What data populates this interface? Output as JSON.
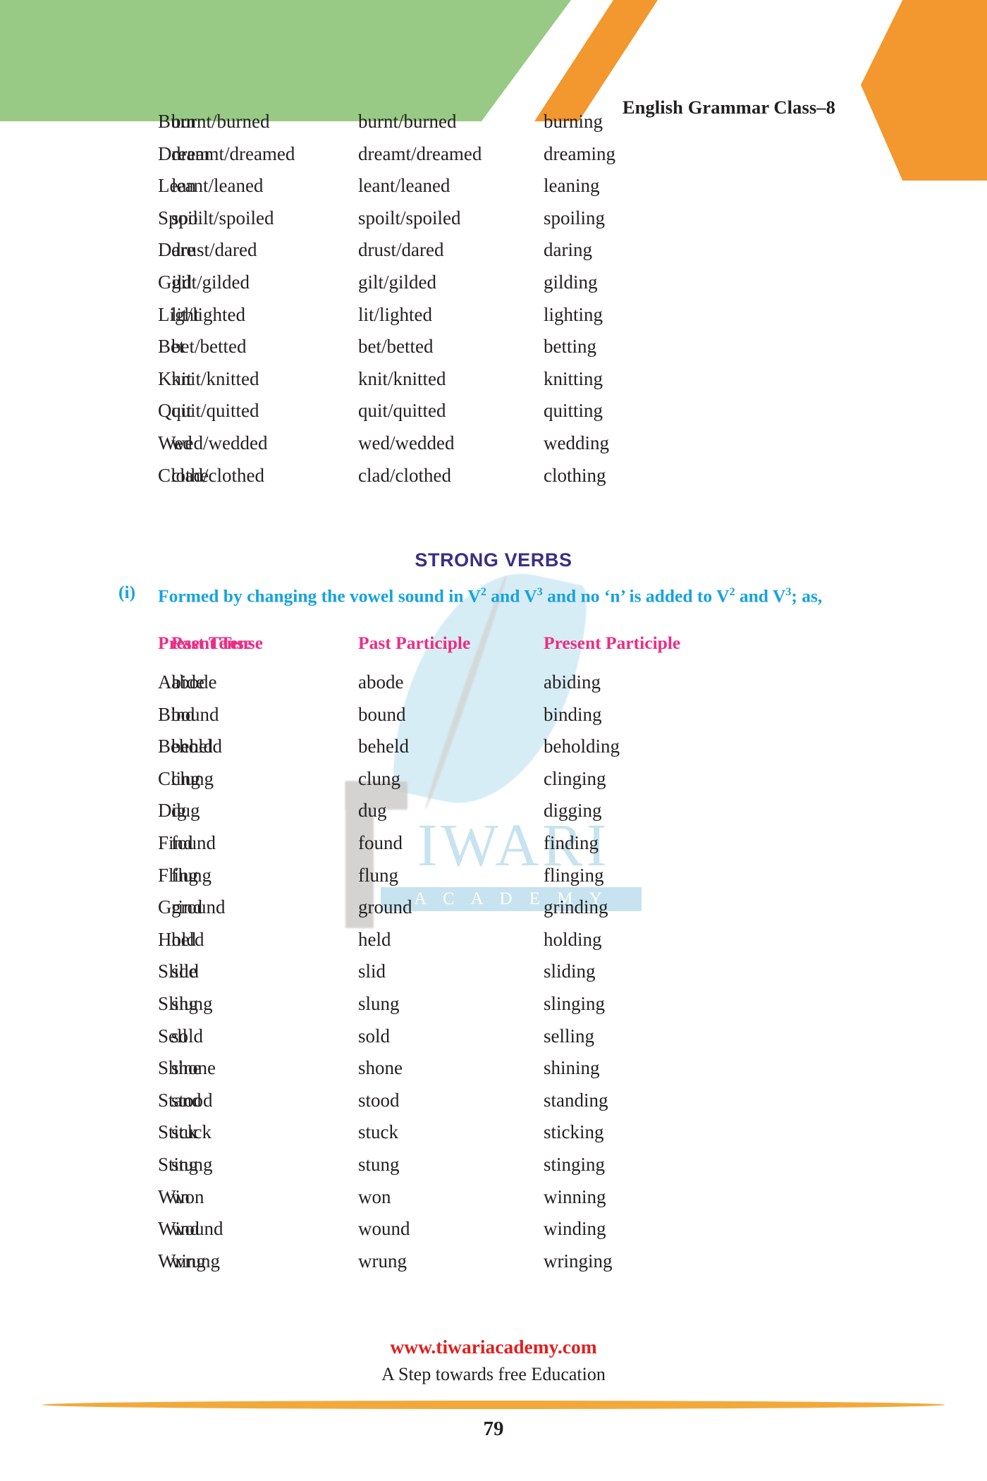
{
  "header": {
    "title": "English Grammar Class–8",
    "colors": {
      "green": "#98ca85",
      "orange": "#f2982f"
    }
  },
  "watermark": {
    "brand_line1": "IWARI",
    "brand_line2": "A C A D E M Y"
  },
  "weak_verbs_table": {
    "rows": [
      [
        "Burn",
        "burnt/burned",
        "burnt/burned",
        "burning"
      ],
      [
        "Dream",
        "dreamt/dreamed",
        "dreamt/dreamed",
        "dreaming"
      ],
      [
        "Lean",
        "leant/leaned",
        "leant/leaned",
        "leaning"
      ],
      [
        "Spoil",
        "spoilt/spoiled",
        "spoilt/spoiled",
        "spoiling"
      ],
      [
        "Dare",
        "drust/dared",
        "drust/dared",
        "daring"
      ],
      [
        "Gild",
        "gilt/gilded",
        "gilt/gilded",
        "gilding"
      ],
      [
        "Light",
        "lit/lighted",
        "lit/lighted",
        "lighting"
      ],
      [
        "Bet",
        "bet/betted",
        "bet/betted",
        "betting"
      ],
      [
        "Knit",
        "knit/knitted",
        "knit/knitted",
        "knitting"
      ],
      [
        "Quit",
        "quit/quitted",
        "quit/quitted",
        "quitting"
      ],
      [
        "Wed",
        "wed/wedded",
        "wed/wedded",
        "wedding"
      ],
      [
        "Clothe",
        "clad/clothed",
        "clad/clothed",
        "clothing"
      ]
    ]
  },
  "strong_verbs_section": {
    "heading": "STRONG VERBS",
    "heading_color": "#3a2f86",
    "rule_number": "(i)",
    "rule_text_parts": {
      "a": "Formed by changing the vowel sound in V",
      "sup1": "2",
      "b": " and V",
      "sup2": "3",
      "c": " and no ‘n’ is added to V",
      "sup3": "2",
      "d": " and V",
      "sup4": "3",
      "e": "; as,"
    },
    "rule_color": "#17a2e0",
    "column_headers": [
      "Present Tense",
      "Past Tense",
      "Past Participle",
      "Present Participle"
    ],
    "column_header_color": "#ec2d84",
    "rows": [
      [
        "Abide",
        "abode",
        "abode",
        "abiding"
      ],
      [
        "Bind",
        "bound",
        "bound",
        "binding"
      ],
      [
        "Behold",
        "beheld",
        "beheld",
        "beholding"
      ],
      [
        "Cling",
        "clung",
        "clung",
        "clinging"
      ],
      [
        "Dig",
        "dug",
        "dug",
        "digging"
      ],
      [
        "Find",
        "found",
        "found",
        "finding"
      ],
      [
        "Fling",
        "flung",
        "flung",
        "flinging"
      ],
      [
        "Grind",
        "ground",
        "ground",
        "grinding"
      ],
      [
        "Hold",
        "held",
        "held",
        "holding"
      ],
      [
        "Slide",
        "slid",
        "slid",
        "sliding"
      ],
      [
        "Sling",
        "slung",
        "slung",
        "slinging"
      ],
      [
        "Sell",
        "sold",
        "sold",
        "selling"
      ],
      [
        "Shine",
        "shone",
        "shone",
        "shining"
      ],
      [
        "Stand",
        "stood",
        "stood",
        "standing"
      ],
      [
        "Stick",
        "stuck",
        "stuck",
        "sticking"
      ],
      [
        "Sting",
        "stung",
        "stung",
        "stinging"
      ],
      [
        "Win",
        "won",
        "won",
        "winning"
      ],
      [
        "Wind",
        "wound",
        "wound",
        "winding"
      ],
      [
        "Wring",
        "wrung",
        "wrung",
        "wringing"
      ]
    ]
  },
  "footer": {
    "url": "www.tiwariacademy.com",
    "url_color": "#e02020",
    "tagline": "A Step towards free Education",
    "page_number": "79",
    "rule_color": "#f2a93b"
  }
}
